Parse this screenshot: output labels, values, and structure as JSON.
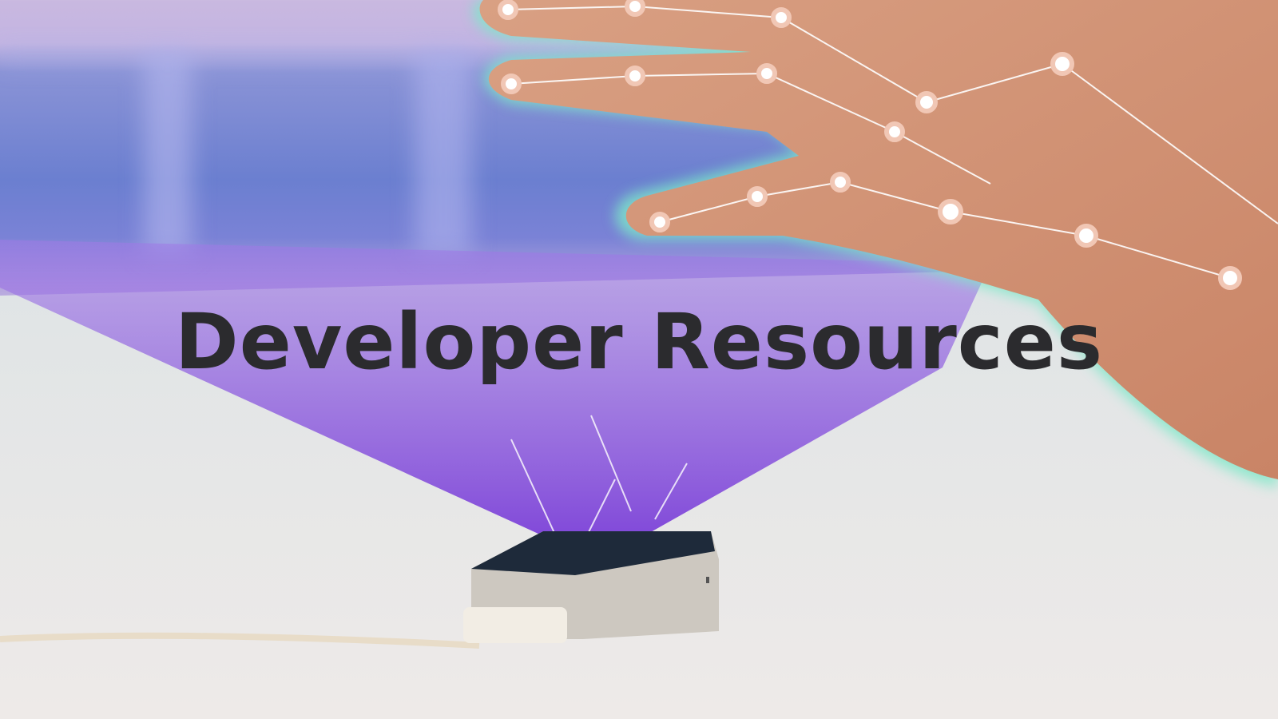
{
  "hero": {
    "title": "Developer Resources",
    "image": "hand-tracking-device-photo"
  },
  "colors": {
    "title": "#2b2b2e",
    "beam": "#8a4fe0",
    "hand_glow": "#7de8c8"
  }
}
